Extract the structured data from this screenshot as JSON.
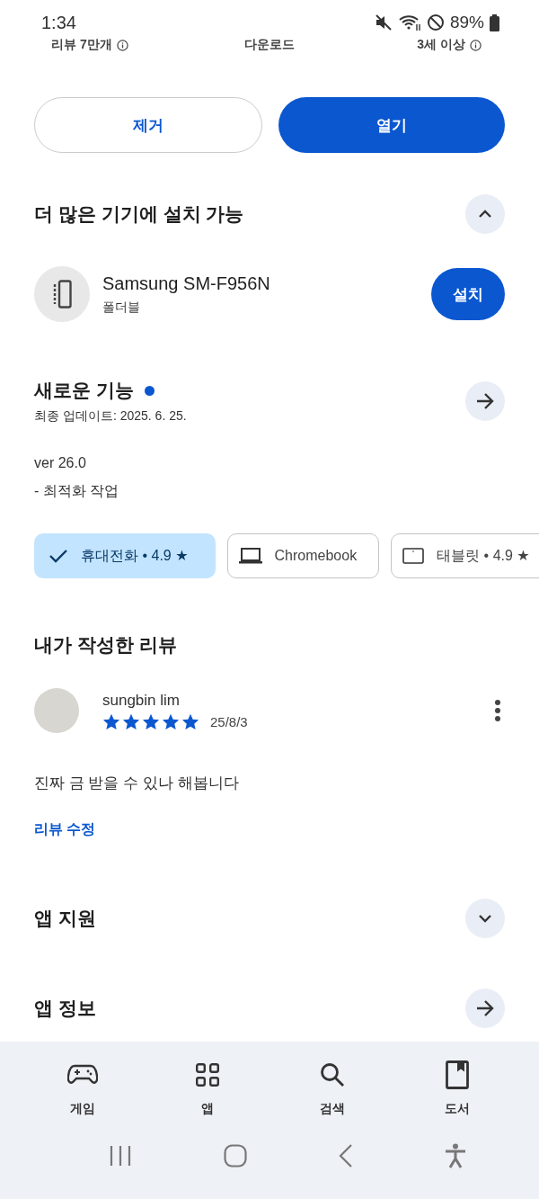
{
  "status_bar": {
    "time": "1:34",
    "battery": "89%"
  },
  "stats": [
    {
      "label": "리뷰 7만개",
      "info": true
    },
    {
      "label": "다운로드",
      "info": false
    },
    {
      "label": "3세 이상",
      "info": true
    }
  ],
  "actions": [
    {
      "label": "제거",
      "kind": "outlined"
    },
    {
      "label": "열기",
      "kind": "filled"
    }
  ],
  "more_devices": {
    "title": "더 많은 기기에 설치 가능",
    "expanded": true,
    "device": {
      "name": "Samsung SM-F956N",
      "type": "폴더블",
      "button": "설치"
    }
  },
  "whats_new": {
    "title": "새로운 기능",
    "new": true,
    "updated": "최종 업데이트: 2025. 6. 25.",
    "notes": [
      "ver 26.0",
      "- 최적화 작업"
    ]
  },
  "device_chips": [
    {
      "label": "휴대전화 • 4.9 ★",
      "selected": true
    },
    {
      "label": "Chromebook",
      "kind": "laptop",
      "selected": false
    },
    {
      "label": "태블릿 • 4.9 ★",
      "kind": "tablet",
      "selected": false
    }
  ],
  "my_review": {
    "title": "내가 작성한 리뷰",
    "author": "sungbin lim",
    "stars": 5,
    "date": "25/8/3",
    "text": "진짜 금 받을 수 있나 해봅니다",
    "edit_link": "리뷰 수정"
  },
  "sections": [
    {
      "title": "앱 지원",
      "kind": "expand"
    },
    {
      "title": "앱 정보",
      "kind": "arrow"
    }
  ],
  "bottom_nav": [
    {
      "label": "게임",
      "kind": "games"
    },
    {
      "label": "앱",
      "kind": "apps"
    },
    {
      "label": "검색",
      "kind": "search"
    },
    {
      "label": "도서",
      "kind": "books"
    }
  ]
}
